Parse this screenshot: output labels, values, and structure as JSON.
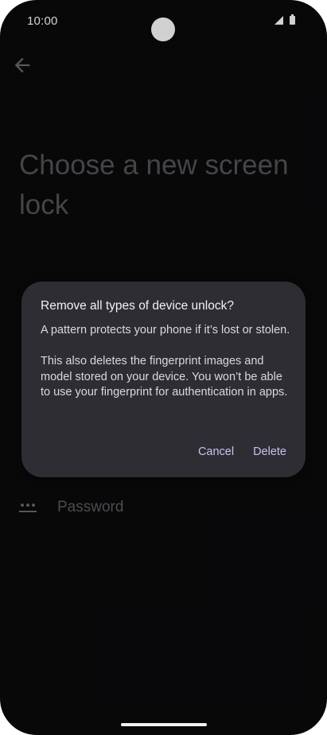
{
  "status_bar": {
    "time": "10:00"
  },
  "page": {
    "title": "Choose a new screen lock"
  },
  "options": [
    {
      "label": "Password",
      "icon": "password-dots-icon"
    }
  ],
  "dialog": {
    "title": "Remove all types of device unlock?",
    "body": [
      "A pattern protects your phone if it’s lost or stolen.",
      "This also deletes the fingerprint images and model stored on your device. You won’t be able to use your fingerprint for authentication in apps."
    ],
    "cancel_label": "Cancel",
    "delete_label": "Delete"
  },
  "colors": {
    "background": "#0a0a0c",
    "dialog": "#2e2d33",
    "accent": "#c9c2f0"
  }
}
